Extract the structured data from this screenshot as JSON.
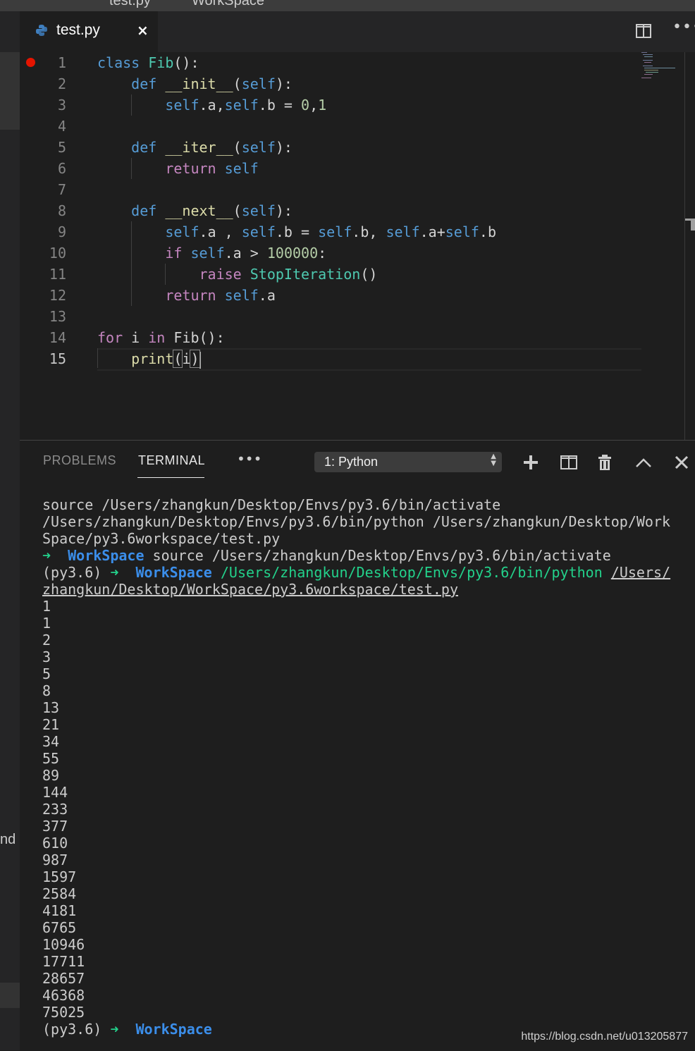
{
  "window": {
    "title_left": "test.py",
    "title_right": "WorkSpace"
  },
  "tab": {
    "icon": "python-icon",
    "filename": "test.py",
    "close": "×"
  },
  "editor_actions": {
    "split": "split-editor-icon",
    "more": "•••"
  },
  "editor": {
    "breakpoint_line": 1,
    "active_line": 15,
    "lines": [
      {
        "n": "1",
        "seg": [
          [
            "kw",
            "class"
          ],
          [
            "",
            " "
          ],
          [
            "cls",
            "Fib"
          ],
          [
            "",
            "():"
          ]
        ]
      },
      {
        "n": "2",
        "seg": [
          [
            "",
            "    "
          ],
          [
            "kw",
            "def"
          ],
          [
            "",
            " "
          ],
          [
            "fn",
            "__init__"
          ],
          [
            "",
            "("
          ],
          [
            "selfk",
            "self"
          ],
          [
            "",
            "):"
          ]
        ]
      },
      {
        "n": "3",
        "seg": [
          [
            "",
            "        "
          ],
          [
            "selfk",
            "self"
          ],
          [
            "",
            ".a,"
          ],
          [
            "selfk",
            "self"
          ],
          [
            "",
            ".b = "
          ],
          [
            "num",
            "0"
          ],
          [
            "",
            ","
          ],
          [
            "num",
            "1"
          ]
        ]
      },
      {
        "n": "4",
        "seg": []
      },
      {
        "n": "5",
        "seg": [
          [
            "",
            "    "
          ],
          [
            "kw",
            "def"
          ],
          [
            "",
            " "
          ],
          [
            "fn",
            "__iter__"
          ],
          [
            "",
            "("
          ],
          [
            "selfk",
            "self"
          ],
          [
            "",
            "):"
          ]
        ]
      },
      {
        "n": "6",
        "seg": [
          [
            "",
            "        "
          ],
          [
            "ctl",
            "return"
          ],
          [
            "",
            " "
          ],
          [
            "selfk",
            "self"
          ]
        ]
      },
      {
        "n": "7",
        "seg": []
      },
      {
        "n": "8",
        "seg": [
          [
            "",
            "    "
          ],
          [
            "kw",
            "def"
          ],
          [
            "",
            " "
          ],
          [
            "fn",
            "__next__"
          ],
          [
            "",
            "("
          ],
          [
            "selfk",
            "self"
          ],
          [
            "",
            "):"
          ]
        ]
      },
      {
        "n": "9",
        "seg": [
          [
            "",
            "        "
          ],
          [
            "selfk",
            "self"
          ],
          [
            "",
            ".a , "
          ],
          [
            "selfk",
            "self"
          ],
          [
            "",
            ".b = "
          ],
          [
            "selfk",
            "self"
          ],
          [
            "",
            ".b, "
          ],
          [
            "selfk",
            "self"
          ],
          [
            "",
            ".a+"
          ],
          [
            "selfk",
            "self"
          ],
          [
            "",
            ".b"
          ]
        ]
      },
      {
        "n": "10",
        "seg": [
          [
            "",
            "        "
          ],
          [
            "ctl",
            "if"
          ],
          [
            "",
            " "
          ],
          [
            "selfk",
            "self"
          ],
          [
            "",
            ".a > "
          ],
          [
            "num",
            "100000"
          ],
          [
            "",
            ":"
          ]
        ]
      },
      {
        "n": "11",
        "seg": [
          [
            "",
            "            "
          ],
          [
            "ctl",
            "raise"
          ],
          [
            "",
            " "
          ],
          [
            "cls",
            "StopIteration"
          ],
          [
            "",
            "()"
          ]
        ]
      },
      {
        "n": "12",
        "seg": [
          [
            "",
            "        "
          ],
          [
            "ctl",
            "return"
          ],
          [
            "",
            " "
          ],
          [
            "selfk",
            "self"
          ],
          [
            "",
            ".a"
          ]
        ]
      },
      {
        "n": "13",
        "seg": []
      },
      {
        "n": "14",
        "seg": [
          [
            "ctl",
            "for"
          ],
          [
            "",
            " i "
          ],
          [
            "ctl",
            "in"
          ],
          [
            "",
            " "
          ],
          [
            "",
            "Fib"
          ],
          [
            "",
            "():"
          ]
        ]
      },
      {
        "n": "15",
        "seg": [
          [
            "",
            "    "
          ],
          [
            "fn",
            "print"
          ],
          [
            "bracket",
            "("
          ],
          [
            "",
            "i"
          ],
          [
            "bracket",
            ")"
          ],
          [
            "cursor",
            ""
          ]
        ]
      }
    ]
  },
  "panel": {
    "tabs": [
      "PROBLEMS",
      "TERMINAL"
    ],
    "more": "•••",
    "terminal_select": "1: Python",
    "actions": [
      "add-terminal-icon",
      "split-terminal-icon",
      "trash-icon",
      "maximize-panel-icon",
      "close-panel-icon"
    ]
  },
  "terminal": {
    "lines": [
      [
        [
          "",
          "source /Users/zhangkun/Desktop/Envs/py3.6/bin/activate"
        ]
      ],
      [
        [
          "",
          "/Users/zhangkun/Desktop/Envs/py3.6/bin/python /Users/zhangkun/Desktop/Work"
        ]
      ],
      [
        [
          "",
          "Space/py3.6workspace/test.py"
        ]
      ],
      [
        [
          "g",
          "➜"
        ],
        [
          "",
          "  "
        ],
        [
          "b",
          "WorkSpace"
        ],
        [
          "",
          " source /Users/zhangkun/Desktop/Envs/py3.6/bin/activate"
        ]
      ],
      [
        [
          "",
          "(py3.6) "
        ],
        [
          "g",
          "➜"
        ],
        [
          "",
          "  "
        ],
        [
          "b",
          "WorkSpace"
        ],
        [
          "",
          " "
        ],
        [
          "gp",
          "/Users/zhangkun/Desktop/Envs/py3.6/bin/python"
        ],
        [
          "",
          " "
        ],
        [
          "u",
          "/Users/"
        ]
      ],
      [
        [
          "u",
          "zhangkun/Desktop/WorkSpace/py3.6workspace/test.py"
        ]
      ],
      [
        [
          "",
          "1"
        ]
      ],
      [
        [
          "",
          "1"
        ]
      ],
      [
        [
          "",
          "2"
        ]
      ],
      [
        [
          "",
          "3"
        ]
      ],
      [
        [
          "",
          "5"
        ]
      ],
      [
        [
          "",
          "8"
        ]
      ],
      [
        [
          "",
          "13"
        ]
      ],
      [
        [
          "",
          "21"
        ]
      ],
      [
        [
          "",
          "34"
        ]
      ],
      [
        [
          "",
          "55"
        ]
      ],
      [
        [
          "",
          "89"
        ]
      ],
      [
        [
          "",
          "144"
        ]
      ],
      [
        [
          "",
          "233"
        ]
      ],
      [
        [
          "",
          "377"
        ]
      ],
      [
        [
          "",
          "610"
        ]
      ],
      [
        [
          "",
          "987"
        ]
      ],
      [
        [
          "",
          "1597"
        ]
      ],
      [
        [
          "",
          "2584"
        ]
      ],
      [
        [
          "",
          "4181"
        ]
      ],
      [
        [
          "",
          "6765"
        ]
      ],
      [
        [
          "",
          "10946"
        ]
      ],
      [
        [
          "",
          "17711"
        ]
      ],
      [
        [
          "",
          "28657"
        ]
      ],
      [
        [
          "",
          "46368"
        ]
      ],
      [
        [
          "",
          "75025"
        ]
      ],
      [
        [
          "",
          "(py3.6) "
        ],
        [
          "g",
          "➜"
        ],
        [
          "",
          "  "
        ],
        [
          "b",
          "WorkSpace"
        ]
      ]
    ]
  },
  "ghost_text": "nd",
  "watermark": "https://blog.csdn.net/u013205877"
}
